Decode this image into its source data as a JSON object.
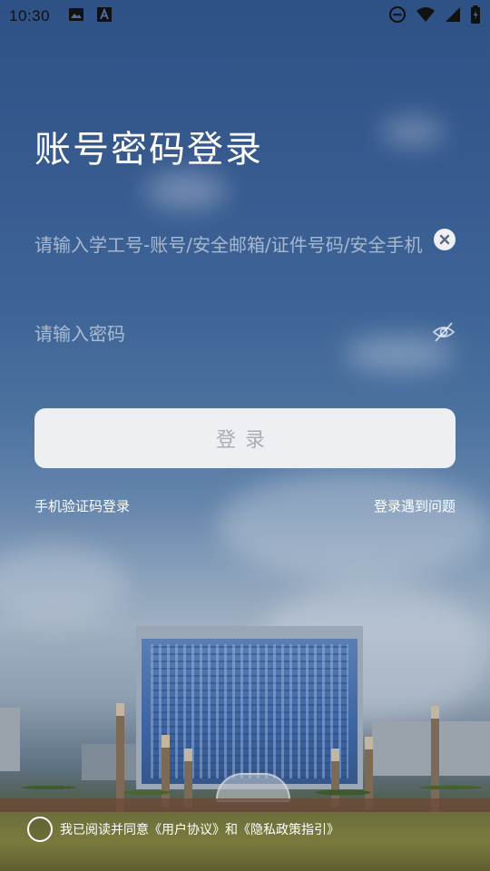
{
  "status_bar": {
    "time": "10:30"
  },
  "page": {
    "title": "账号密码登录"
  },
  "form": {
    "account_placeholder": "请输入学工号-账号/安全邮箱/证件号码/安全手机",
    "password_placeholder": "请输入密码",
    "login_label": "登录"
  },
  "links": {
    "sms_login": "手机验证码登录",
    "trouble": "登录遇到问题"
  },
  "agreement": {
    "prefix": "我已阅读并同意",
    "user_agreement": "《用户协议》",
    "and": "和",
    "privacy": "《隐私政策指引》"
  },
  "icons": {
    "status": [
      "image-icon",
      "accessibility-icon",
      "do-not-disturb-icon",
      "wifi-icon",
      "signal-icon",
      "battery-icon"
    ],
    "clear": "close-icon",
    "password_visibility": "eye-off-icon"
  },
  "colors": {
    "button_bg": "#eeeff3",
    "button_text": "#a9adb6"
  }
}
